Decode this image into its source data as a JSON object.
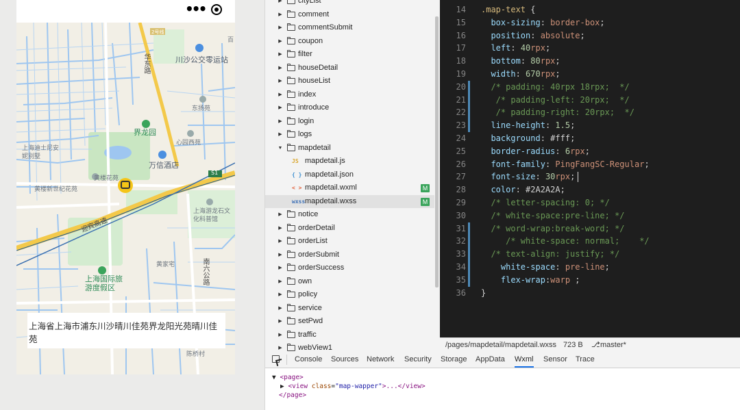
{
  "simulator": {
    "menu_glyph": "•••",
    "map_labels": [
      {
        "text": "川沙公交零运站",
        "kind": "poi"
      },
      {
        "text": "华东路",
        "kind": "road"
      },
      {
        "text": "界龙园",
        "kind": "green"
      },
      {
        "text": "万信酒店",
        "kind": "poi"
      },
      {
        "text": "上海迪士尼安妮别墅",
        "kind": "poi"
      },
      {
        "text": "黄楼新世纪花苑",
        "kind": "poi"
      },
      {
        "text": "黄楼花苑",
        "kind": "poi"
      },
      {
        "text": "迎宾高速",
        "kind": "road"
      },
      {
        "text": "上海游龙石文化科普馆",
        "kind": "poi"
      },
      {
        "text": "上海国际旅游度假区",
        "kind": "green"
      },
      {
        "text": "东扬苑",
        "kind": "small"
      },
      {
        "text": "心园西苑",
        "kind": "small"
      },
      {
        "text": "黄家宅",
        "kind": "small"
      },
      {
        "text": "南六公路",
        "kind": "road"
      },
      {
        "text": "陈桥村",
        "kind": "small"
      },
      {
        "text": "S1",
        "kind": "shield"
      },
      {
        "text": "2号线",
        "kind": "shield"
      },
      {
        "text": "百",
        "kind": "small"
      }
    ],
    "address_text": "上海省上海市浦东川沙晴川佳苑界龙阳光苑晴川佳苑"
  },
  "file_tree": {
    "items": [
      {
        "name": "cityList",
        "type": "folder",
        "expanded": false
      },
      {
        "name": "comment",
        "type": "folder",
        "expanded": false
      },
      {
        "name": "commentSubmit",
        "type": "folder",
        "expanded": false
      },
      {
        "name": "coupon",
        "type": "folder",
        "expanded": false
      },
      {
        "name": "filter",
        "type": "folder",
        "expanded": false
      },
      {
        "name": "houseDetail",
        "type": "folder",
        "expanded": false
      },
      {
        "name": "houseList",
        "type": "folder",
        "expanded": false
      },
      {
        "name": "index",
        "type": "folder",
        "expanded": false
      },
      {
        "name": "introduce",
        "type": "folder",
        "expanded": false
      },
      {
        "name": "login",
        "type": "folder",
        "expanded": false
      },
      {
        "name": "logs",
        "type": "folder",
        "expanded": false
      },
      {
        "name": "mapdetail",
        "type": "folder",
        "expanded": true
      },
      {
        "name": "mapdetail.js",
        "type": "file",
        "icon": "JS",
        "icon_color": "#d9a52a"
      },
      {
        "name": "mapdetail.json",
        "type": "file",
        "icon": "{ }",
        "icon_color": "#3b8ed0"
      },
      {
        "name": "mapdetail.wxml",
        "type": "file",
        "icon": "< >",
        "icon_color": "#e2603a",
        "badge": "M"
      },
      {
        "name": "mapdetail.wxss",
        "type": "file",
        "icon": "wxss",
        "icon_color": "#3b6fb5",
        "badge": "M",
        "selected": true
      },
      {
        "name": "notice",
        "type": "folder",
        "expanded": false
      },
      {
        "name": "orderDetail",
        "type": "folder",
        "expanded": false
      },
      {
        "name": "orderList",
        "type": "folder",
        "expanded": false
      },
      {
        "name": "orderSubmit",
        "type": "folder",
        "expanded": false
      },
      {
        "name": "orderSuccess",
        "type": "folder",
        "expanded": false
      },
      {
        "name": "own",
        "type": "folder",
        "expanded": false
      },
      {
        "name": "policy",
        "type": "folder",
        "expanded": false
      },
      {
        "name": "service",
        "type": "folder",
        "expanded": false
      },
      {
        "name": "setPwd",
        "type": "folder",
        "expanded": false
      },
      {
        "name": "traffic",
        "type": "folder",
        "expanded": false
      },
      {
        "name": "webView1",
        "type": "folder",
        "expanded": false
      }
    ]
  },
  "editor": {
    "lines": [
      {
        "n": "14",
        "tokens": [
          [
            "sel",
            ".map-text"
          ],
          [
            "punc",
            " {"
          ]
        ]
      },
      {
        "n": "15",
        "tokens": [
          [
            "punc",
            "  "
          ],
          [
            "prop",
            "box-sizing"
          ],
          [
            "punc",
            ": "
          ],
          [
            "val",
            "border-box"
          ],
          [
            "punc",
            ";"
          ]
        ]
      },
      {
        "n": "16",
        "tokens": [
          [
            "punc",
            "  "
          ],
          [
            "prop",
            "position"
          ],
          [
            "punc",
            ": "
          ],
          [
            "val",
            "absolute"
          ],
          [
            "punc",
            ";"
          ]
        ]
      },
      {
        "n": "17",
        "tokens": [
          [
            "punc",
            "  "
          ],
          [
            "prop",
            "left"
          ],
          [
            "punc",
            ": "
          ],
          [
            "num",
            "40"
          ],
          [
            "unit",
            "rpx"
          ],
          [
            "punc",
            ";"
          ]
        ]
      },
      {
        "n": "18",
        "tokens": [
          [
            "punc",
            "  "
          ],
          [
            "prop",
            "bottom"
          ],
          [
            "punc",
            ": "
          ],
          [
            "num",
            "80"
          ],
          [
            "unit",
            "rpx"
          ],
          [
            "punc",
            ";"
          ]
        ]
      },
      {
        "n": "19",
        "tokens": [
          [
            "punc",
            "  "
          ],
          [
            "prop",
            "width"
          ],
          [
            "punc",
            ": "
          ],
          [
            "num",
            "670"
          ],
          [
            "unit",
            "rpx"
          ],
          [
            "punc",
            ";"
          ]
        ]
      },
      {
        "n": "20",
        "tokens": [
          [
            "com",
            "  /* padding: 40rpx 18rpx;  */"
          ]
        ]
      },
      {
        "n": "21",
        "tokens": [
          [
            "com",
            "   /* padding-left: 20rpx;  */"
          ]
        ]
      },
      {
        "n": "22",
        "tokens": [
          [
            "com",
            "   /* padding-right: 20rpx;  */"
          ]
        ]
      },
      {
        "n": "23",
        "tokens": [
          [
            "punc",
            "  "
          ],
          [
            "prop",
            "line-height"
          ],
          [
            "punc",
            ": "
          ],
          [
            "num",
            "1.5"
          ],
          [
            "punc",
            ";"
          ]
        ]
      },
      {
        "n": "24",
        "tokens": [
          [
            "punc",
            "  "
          ],
          [
            "prop",
            "background"
          ],
          [
            "punc",
            ": "
          ],
          [
            "punc",
            "#fff"
          ],
          [
            "punc",
            ";"
          ]
        ]
      },
      {
        "n": "25",
        "tokens": [
          [
            "punc",
            "  "
          ],
          [
            "prop",
            "border-radius"
          ],
          [
            "punc",
            ": "
          ],
          [
            "num",
            "6"
          ],
          [
            "unit",
            "rpx"
          ],
          [
            "punc",
            ";"
          ]
        ]
      },
      {
        "n": "26",
        "tokens": [
          [
            "punc",
            "  "
          ],
          [
            "prop",
            "font-family"
          ],
          [
            "punc",
            ": "
          ],
          [
            "val",
            "PingFangSC-Regular"
          ],
          [
            "punc",
            ";"
          ]
        ]
      },
      {
        "n": "27",
        "tokens": [
          [
            "punc",
            "  "
          ],
          [
            "prop",
            "font-size"
          ],
          [
            "punc",
            ": "
          ],
          [
            "num",
            "30"
          ],
          [
            "unit",
            "rpx"
          ],
          [
            "punc",
            ";"
          ]
        ]
      },
      {
        "n": "28",
        "tokens": [
          [
            "punc",
            "  "
          ],
          [
            "prop",
            "color"
          ],
          [
            "punc",
            ": "
          ],
          [
            "punc",
            "#2A2A2A"
          ],
          [
            "punc",
            ";"
          ]
        ]
      },
      {
        "n": "29",
        "tokens": [
          [
            "com",
            "  /* letter-spacing: 0; */"
          ]
        ]
      },
      {
        "n": "30",
        "tokens": [
          [
            "com",
            "  /* white-space:pre-line; */"
          ]
        ]
      },
      {
        "n": "31",
        "tokens": [
          [
            "com",
            "  /* word-wrap:break-word; */"
          ]
        ]
      },
      {
        "n": "32",
        "tokens": [
          [
            "com",
            "     /* white-space: normal;    */"
          ]
        ]
      },
      {
        "n": "33",
        "tokens": [
          [
            "com",
            "  /* text-align: justify; */"
          ]
        ]
      },
      {
        "n": "34",
        "tokens": [
          [
            "punc",
            "    "
          ],
          [
            "prop",
            "white-space"
          ],
          [
            "punc",
            ": "
          ],
          [
            "val",
            "pre-line"
          ],
          [
            "punc",
            ";"
          ]
        ]
      },
      {
        "n": "35",
        "tokens": [
          [
            "punc",
            "    "
          ],
          [
            "prop",
            "flex-wrap"
          ],
          [
            "punc",
            ":"
          ],
          [
            "val",
            "warp"
          ],
          [
            "punc",
            " ;"
          ]
        ]
      },
      {
        "n": "36",
        "tokens": [
          [
            "punc",
            "}"
          ]
        ]
      }
    ]
  },
  "status_bar": {
    "path": "/pages/mapdetail/mapdetail.wxss",
    "size": "723 B",
    "branch": "master*"
  },
  "devtools": {
    "tabs": [
      "Console",
      "Sources",
      "Network",
      "Security",
      "Storage",
      "AppData",
      "Wxml",
      "Sensor",
      "Trace"
    ],
    "active_tab": "Wxml",
    "wxml": {
      "open_page": "<page>",
      "view_open": "<view",
      "attr_name": "class",
      "attr_value": "\"map-wapper\"",
      "view_rest": ">...</view>",
      "close_page": "</page>"
    }
  },
  "colors": {
    "editor_bg": "#1e1e1e",
    "badge_green": "#3aa45b",
    "map_road_yellow": "#f3c94a",
    "map_water": "#9ec6f0",
    "map_green": "#c9e6c2"
  }
}
